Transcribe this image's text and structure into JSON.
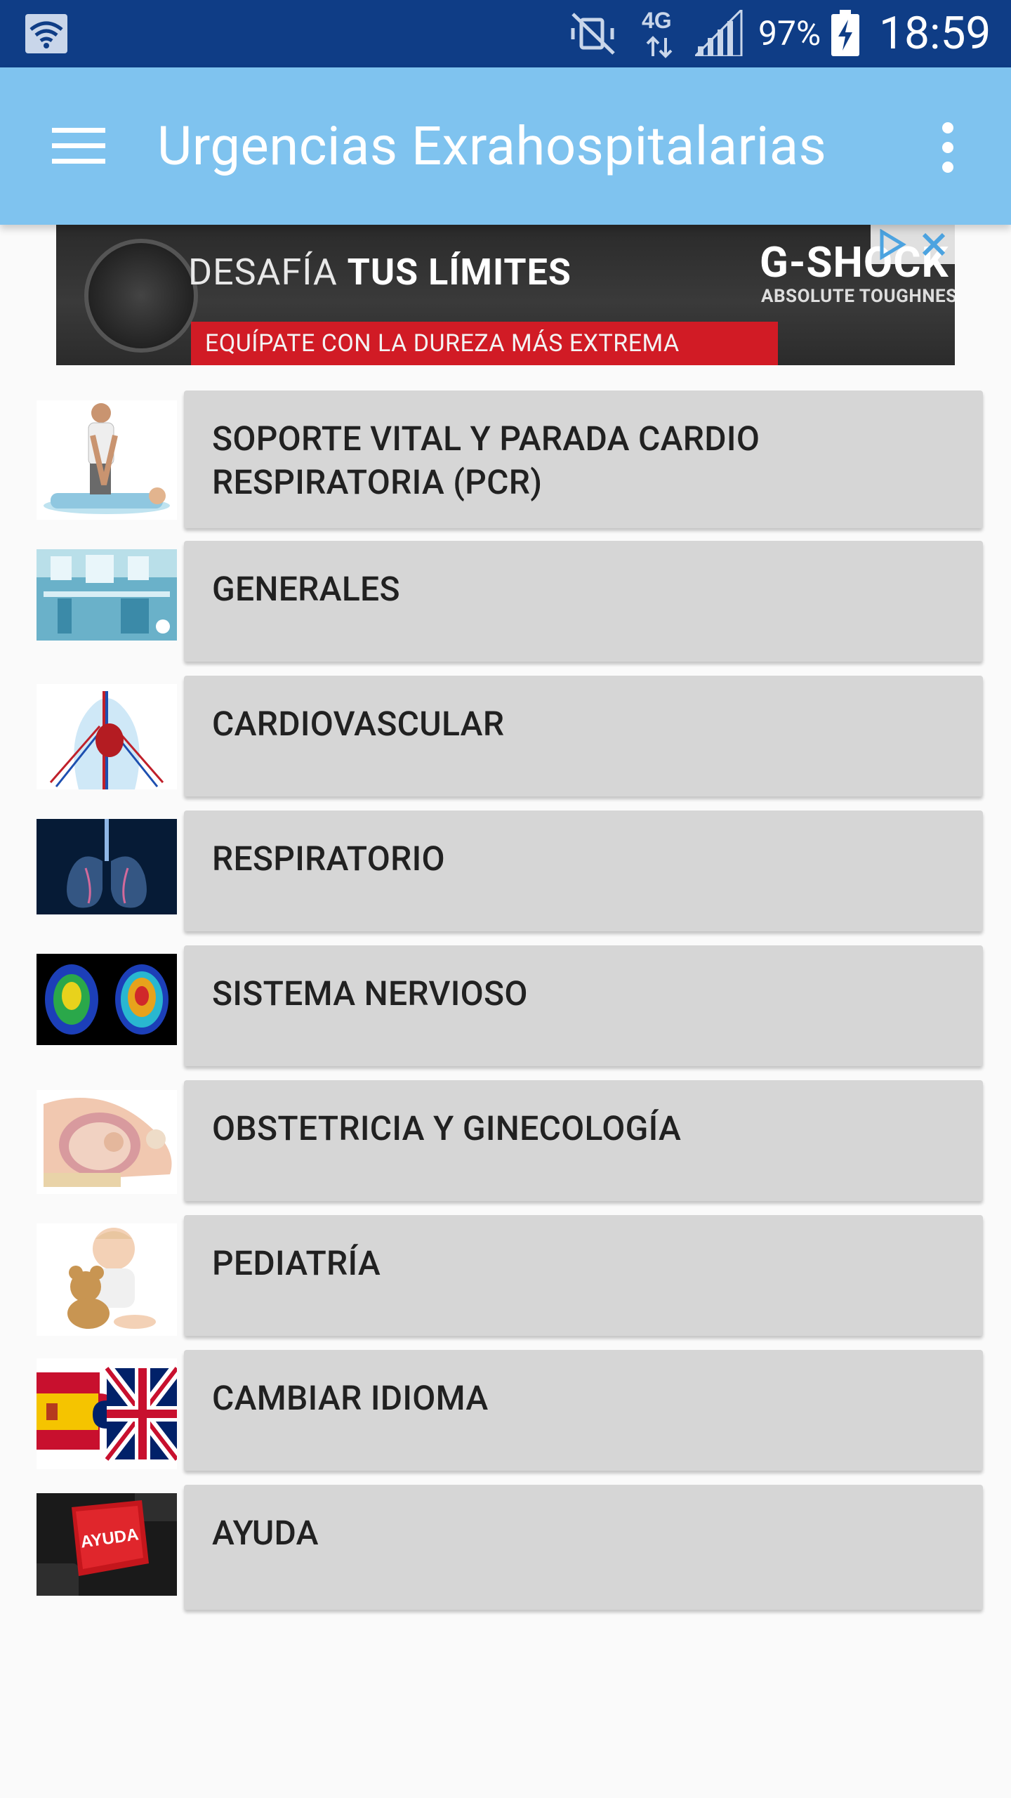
{
  "status_bar": {
    "battery_percent": "97%",
    "time": "18:59",
    "network_type": "4G",
    "icons": [
      "wifi-icon",
      "vibrate-off-icon",
      "network-4g-icon",
      "signal-icon",
      "battery-charging-icon"
    ]
  },
  "app_bar": {
    "title": "Urgencias Exrahospitalarias",
    "menu_icon": "menu-icon",
    "more_icon": "more-vert-icon"
  },
  "ad": {
    "headline_part1": "DESAFÍA ",
    "headline_part2": "TUS LÍMITES",
    "subline": "EQUÍPATE CON LA DUREZA MÁS EXTREMA",
    "brand": "G-SHOCK",
    "tagline": "ABSOLUTE TOUGHNESS"
  },
  "menu": {
    "items": [
      {
        "label": "SOPORTE VITAL Y PARADA CARDIO RESPIRATORIA (PCR)",
        "image": "cpr-image"
      },
      {
        "label": "GENERALES",
        "image": "hospital-image"
      },
      {
        "label": "CARDIOVASCULAR",
        "image": "circulatory-system-image"
      },
      {
        "label": "RESPIRATORIO",
        "image": "lungs-image"
      },
      {
        "label": "SISTEMA NERVIOSO",
        "image": "brain-scan-image"
      },
      {
        "label": "OBSTETRICIA Y GINECOLOGÍA",
        "image": "pregnancy-image"
      },
      {
        "label": "PEDIATRÍA",
        "image": "baby-image"
      },
      {
        "label": "CAMBIAR IDIOMA",
        "image": "flags-puzzle-image"
      },
      {
        "label": "AYUDA",
        "image": "help-key-image"
      }
    ]
  },
  "colors": {
    "status_bar": "#0f3d86",
    "app_bar": "#7fc3ef",
    "card": "#d6d6d6",
    "background": "#fafafa"
  }
}
